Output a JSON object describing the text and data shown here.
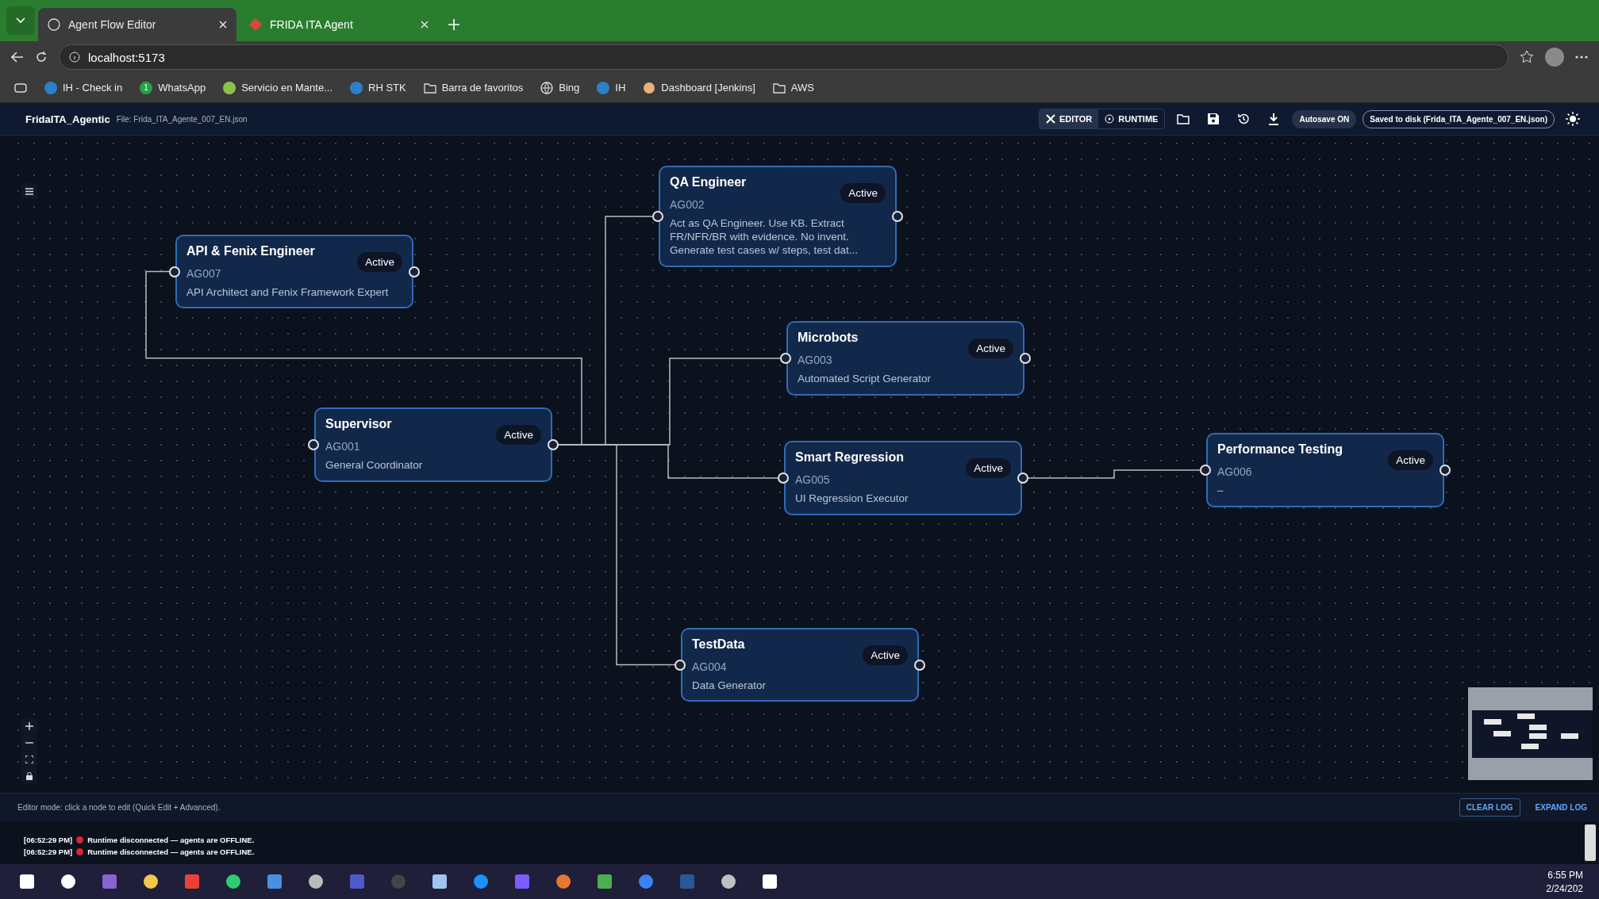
{
  "browser": {
    "tabs": [
      {
        "label": "Agent Flow Editor",
        "selected": true
      },
      {
        "label": "FRIDA ITA Agent",
        "selected": false
      }
    ],
    "address": "localhost:5173",
    "bookmarks": [
      {
        "label": "IH - Check in",
        "kind": "site"
      },
      {
        "label": "WhatsApp",
        "kind": "badge",
        "badge": "1"
      },
      {
        "label": "Servicio en Mante...",
        "kind": "leaf"
      },
      {
        "label": "RH STK",
        "kind": "site"
      },
      {
        "label": "Barra de favoritos",
        "kind": "folder"
      },
      {
        "label": "Bing",
        "kind": "globe"
      },
      {
        "label": "IH",
        "kind": "site"
      },
      {
        "label": "Dashboard [Jenkins]",
        "kind": "avatar"
      },
      {
        "label": "AWS",
        "kind": "folder"
      }
    ]
  },
  "app": {
    "title": "FridaITA_Agentic",
    "file": "File: Frida_ITA_Agente_007_EN.json",
    "modes": [
      {
        "label": "EDITOR",
        "selected": true
      },
      {
        "label": "RUNTIME",
        "selected": false
      }
    ],
    "autosave": "Autosave ON",
    "saved": "Saved to disk (Frida_ITA_Agente_007_EN.json)"
  },
  "nodes": [
    {
      "name": "QA Engineer",
      "code": "AG002",
      "status": "Active",
      "description": "Act as QA Engineer. Use KB. Extract FR/NFR/BR with evidence. No invent. Generate test cases w/ steps, test dat..."
    },
    {
      "name": "API & Fenix Engineer",
      "code": "AG007",
      "status": "Active",
      "description": "API Architect and Fenix Framework Expert"
    },
    {
      "name": "Microbots",
      "code": "AG003",
      "status": "Active",
      "description": "Automated Script Generator"
    },
    {
      "name": "Supervisor",
      "code": "AG001",
      "status": "Active",
      "description": "General Coordinator"
    },
    {
      "name": "Smart Regression",
      "code": "AG005",
      "status": "Active",
      "description": "UI Regression Executor"
    },
    {
      "name": "Performance Testing",
      "code": "AG006",
      "status": "Active",
      "description": "–"
    },
    {
      "name": "TestData",
      "code": "AG004",
      "status": "Active",
      "description": "Data Generator"
    }
  ],
  "status_bar": {
    "hint": "Editor mode: click a node to edit (Quick Edit + Advanced).",
    "buttons": [
      "CLEAR LOG",
      "EXPAND LOG"
    ]
  },
  "log": [
    {
      "time": "[06:52:29 PM]",
      "message": "Runtime disconnected — agents are OFFLINE.",
      "color": "#e0262a"
    },
    {
      "time": "[06:52:29 PM]",
      "message": "Runtime disconnected — agents are OFFLINE.",
      "color": "#e0262a"
    }
  ],
  "taskbar": {
    "time": "6:55 PM",
    "date": "2/24/202"
  }
}
